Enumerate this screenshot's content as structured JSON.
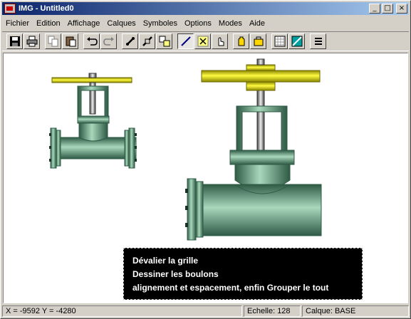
{
  "window": {
    "title": "IMG - Untitled0",
    "controls": {
      "minimize": "_",
      "maximize": "□",
      "close": "×"
    }
  },
  "menu": [
    "Fichier",
    "Edition",
    "Affichage",
    "Calques",
    "Symboles",
    "Options",
    "Modes",
    "Aide"
  ],
  "toolbar": {
    "buttons": [
      "save-icon",
      "print-icon",
      "copy-icon",
      "paste-icon",
      "undo-icon",
      "redo-icon",
      "link-icon",
      "unlink-icon",
      "group-icon",
      "draw-line-icon",
      "select-node-icon",
      "hand-pointer-icon",
      "move-icon",
      "layer-icon",
      "grid-icon",
      "color-icon",
      "menu-lines-icon"
    ]
  },
  "note": {
    "lines": [
      "Dévalier la grille",
      "Dessiner les boulons",
      "alignement et espacement, enfin Grouper le tout"
    ]
  },
  "status": {
    "coords": "X = -9592  Y = -4280",
    "scale": "Echelle:  128",
    "layer": "Calque:  BASE"
  },
  "colors": {
    "pipe_green": "#5f9a7c",
    "handwheel_yellow": "#d9d400",
    "title_blue": "#0a246a"
  }
}
